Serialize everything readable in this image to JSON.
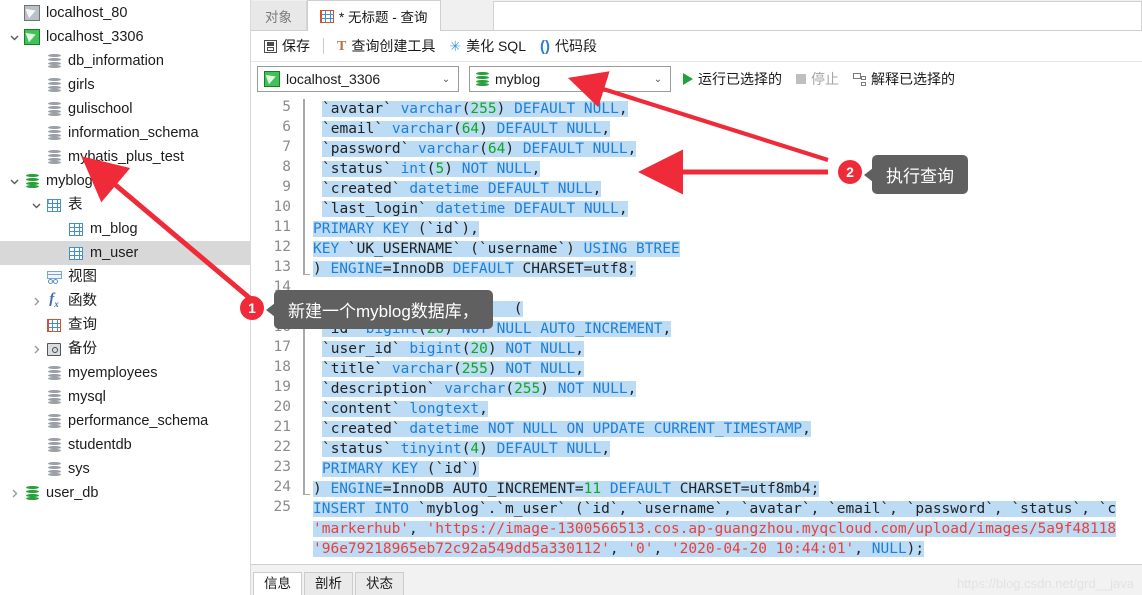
{
  "sidebar": {
    "items": [
      {
        "label": "localhost_80",
        "icon": "connection-icon",
        "indent": 1,
        "twist": "none",
        "state": "off",
        "selected": false
      },
      {
        "label": "localhost_3306",
        "icon": "connection-icon",
        "indent": 0,
        "twist": "down",
        "state": "on",
        "selected": false
      },
      {
        "label": "db_information",
        "icon": "database-icon",
        "indent": 2,
        "twist": "none",
        "state": "off",
        "selected": false
      },
      {
        "label": "girls",
        "icon": "database-icon",
        "indent": 2,
        "twist": "none",
        "state": "off",
        "selected": false
      },
      {
        "label": "gulischool",
        "icon": "database-icon",
        "indent": 2,
        "twist": "none",
        "state": "off",
        "selected": false
      },
      {
        "label": "information_schema",
        "icon": "database-icon",
        "indent": 2,
        "twist": "none",
        "state": "off",
        "selected": false
      },
      {
        "label": "mybatis_plus_test",
        "icon": "database-icon",
        "indent": 2,
        "twist": "none",
        "state": "off",
        "selected": false
      },
      {
        "label": "myblog",
        "icon": "database-icon",
        "indent": 1,
        "twist": "down",
        "state": "on",
        "selected": false
      },
      {
        "label": "表",
        "icon": "tables-folder-icon",
        "indent": 2,
        "twist": "down",
        "state": "off",
        "selected": false
      },
      {
        "label": "m_blog",
        "icon": "table-icon",
        "indent": 3,
        "twist": "none",
        "state": "off",
        "selected": false
      },
      {
        "label": "m_user",
        "icon": "table-icon",
        "indent": 3,
        "twist": "none",
        "state": "off",
        "selected": true
      },
      {
        "label": "视图",
        "icon": "view-icon",
        "indent": 2,
        "twist": "none",
        "state": "off",
        "selected": false
      },
      {
        "label": "函数",
        "icon": "function-icon",
        "indent": 2,
        "twist": "right",
        "state": "off",
        "selected": false
      },
      {
        "label": "查询",
        "icon": "query-icon",
        "indent": 2,
        "twist": "none",
        "state": "off",
        "selected": false
      },
      {
        "label": "备份",
        "icon": "backup-icon",
        "indent": 2,
        "twist": "right",
        "state": "off",
        "selected": false
      },
      {
        "label": "myemployees",
        "icon": "database-icon",
        "indent": 2,
        "twist": "none",
        "state": "off",
        "selected": false
      },
      {
        "label": "mysql",
        "icon": "database-icon",
        "indent": 2,
        "twist": "none",
        "state": "off",
        "selected": false
      },
      {
        "label": "performance_schema",
        "icon": "database-icon",
        "indent": 2,
        "twist": "none",
        "state": "off",
        "selected": false
      },
      {
        "label": "studentdb",
        "icon": "database-icon",
        "indent": 2,
        "twist": "none",
        "state": "off",
        "selected": false
      },
      {
        "label": "sys",
        "icon": "database-icon",
        "indent": 2,
        "twist": "none",
        "state": "off",
        "selected": false
      },
      {
        "label": "user_db",
        "icon": "database-icon",
        "indent": 1,
        "twist": "right",
        "state": "on",
        "selected": false
      }
    ]
  },
  "tabs": {
    "object_tab": "对象",
    "query_tab": "* 无标题 - 查询"
  },
  "toolbar": {
    "save": "保存",
    "query_builder": "查询创建工具",
    "beautify_sql": "美化 SQL",
    "code_snippet": "代码段"
  },
  "connbar": {
    "connection": "localhost_3306",
    "database": "myblog",
    "run_selected": "运行已选择的",
    "stop": "停止",
    "explain_selected": "解释已选择的"
  },
  "editor": {
    "first_line_number": 5,
    "lines": [
      {
        "n": 5,
        "indent": 1,
        "segs": [
          {
            "t": "`avatar` ",
            "c": "pl"
          },
          {
            "t": "varchar",
            "c": "kw"
          },
          {
            "t": "(",
            "c": "pl"
          },
          {
            "t": "255",
            "c": "num"
          },
          {
            "t": ") ",
            "c": "pl"
          },
          {
            "t": "DEFAULT NULL",
            "c": "kw"
          },
          {
            "t": ",",
            "c": "pl"
          }
        ]
      },
      {
        "n": 6,
        "indent": 1,
        "segs": [
          {
            "t": "`email` ",
            "c": "pl"
          },
          {
            "t": "varchar",
            "c": "kw"
          },
          {
            "t": "(",
            "c": "pl"
          },
          {
            "t": "64",
            "c": "num"
          },
          {
            "t": ") ",
            "c": "pl"
          },
          {
            "t": "DEFAULT NULL",
            "c": "kw"
          },
          {
            "t": ",",
            "c": "pl"
          }
        ]
      },
      {
        "n": 7,
        "indent": 1,
        "segs": [
          {
            "t": "`password` ",
            "c": "pl"
          },
          {
            "t": "varchar",
            "c": "kw"
          },
          {
            "t": "(",
            "c": "pl"
          },
          {
            "t": "64",
            "c": "num"
          },
          {
            "t": ") ",
            "c": "pl"
          },
          {
            "t": "DEFAULT NULL",
            "c": "kw"
          },
          {
            "t": ",",
            "c": "pl"
          }
        ]
      },
      {
        "n": 8,
        "indent": 1,
        "segs": [
          {
            "t": "`status` ",
            "c": "pl"
          },
          {
            "t": "int",
            "c": "kw"
          },
          {
            "t": "(",
            "c": "pl"
          },
          {
            "t": "5",
            "c": "num"
          },
          {
            "t": ") ",
            "c": "pl"
          },
          {
            "t": "NOT NULL",
            "c": "kw"
          },
          {
            "t": ",",
            "c": "pl"
          }
        ]
      },
      {
        "n": 9,
        "indent": 1,
        "segs": [
          {
            "t": "`created` ",
            "c": "pl"
          },
          {
            "t": "datetime",
            "c": "kw"
          },
          {
            "t": " ",
            "c": "pl"
          },
          {
            "t": "DEFAULT NULL",
            "c": "kw"
          },
          {
            "t": ",",
            "c": "pl"
          }
        ]
      },
      {
        "n": 10,
        "indent": 1,
        "segs": [
          {
            "t": "`last_login` ",
            "c": "pl"
          },
          {
            "t": "datetime",
            "c": "kw"
          },
          {
            "t": " ",
            "c": "pl"
          },
          {
            "t": "DEFAULT NULL",
            "c": "kw"
          },
          {
            "t": ",",
            "c": "pl"
          }
        ]
      },
      {
        "n": 11,
        "indent": 0,
        "segs": [
          {
            "t": "PRIMARY KEY",
            "c": "kw"
          },
          {
            "t": " (`id`),",
            "c": "pl"
          }
        ]
      },
      {
        "n": 12,
        "indent": 0,
        "segs": [
          {
            "t": "KEY",
            "c": "kw"
          },
          {
            "t": " `UK_USERNAME` (`username`) ",
            "c": "pl"
          },
          {
            "t": "USING BTREE",
            "c": "kw"
          }
        ]
      },
      {
        "n": 13,
        "indent": 0,
        "segs": [
          {
            "t": ") ",
            "c": "pl"
          },
          {
            "t": "ENGINE",
            "c": "kw"
          },
          {
            "t": "=",
            "c": "pl"
          },
          {
            "t": "InnoDB ",
            "c": "pl"
          },
          {
            "t": "DEFAULT",
            "c": "kw"
          },
          {
            "t": " CHARSET=utf8;",
            "c": "pl"
          }
        ]
      },
      {
        "n": 14,
        "indent": 0,
        "segs": [
          {
            "t": "",
            "c": "pl"
          }
        ]
      },
      {
        "n": 15,
        "indent": 0,
        "segs": [
          {
            "t": "CREATE TABLE",
            "c": "kw"
          },
          {
            "t": " `m_blog`  (",
            "c": "pl"
          }
        ]
      },
      {
        "n": 16,
        "indent": 1,
        "segs": [
          {
            "t": "`id` ",
            "c": "pl"
          },
          {
            "t": "bigint",
            "c": "kw"
          },
          {
            "t": "(",
            "c": "pl"
          },
          {
            "t": "20",
            "c": "num"
          },
          {
            "t": ") ",
            "c": "pl"
          },
          {
            "t": "NOT NULL AUTO_INCREMENT",
            "c": "kw"
          },
          {
            "t": ",",
            "c": "pl"
          }
        ]
      },
      {
        "n": 17,
        "indent": 1,
        "segs": [
          {
            "t": "`user_id` ",
            "c": "pl"
          },
          {
            "t": "bigint",
            "c": "kw"
          },
          {
            "t": "(",
            "c": "pl"
          },
          {
            "t": "20",
            "c": "num"
          },
          {
            "t": ") ",
            "c": "pl"
          },
          {
            "t": "NOT NULL",
            "c": "kw"
          },
          {
            "t": ",",
            "c": "pl"
          }
        ]
      },
      {
        "n": 18,
        "indent": 1,
        "segs": [
          {
            "t": "`title` ",
            "c": "pl"
          },
          {
            "t": "varchar",
            "c": "kw"
          },
          {
            "t": "(",
            "c": "pl"
          },
          {
            "t": "255",
            "c": "num"
          },
          {
            "t": ") ",
            "c": "pl"
          },
          {
            "t": "NOT NULL",
            "c": "kw"
          },
          {
            "t": ",",
            "c": "pl"
          }
        ]
      },
      {
        "n": 19,
        "indent": 1,
        "segs": [
          {
            "t": "`description` ",
            "c": "pl"
          },
          {
            "t": "varchar",
            "c": "kw"
          },
          {
            "t": "(",
            "c": "pl"
          },
          {
            "t": "255",
            "c": "num"
          },
          {
            "t": ") ",
            "c": "pl"
          },
          {
            "t": "NOT NULL",
            "c": "kw"
          },
          {
            "t": ",",
            "c": "pl"
          }
        ]
      },
      {
        "n": 20,
        "indent": 1,
        "segs": [
          {
            "t": "`content` ",
            "c": "pl"
          },
          {
            "t": "longtext",
            "c": "kw"
          },
          {
            "t": ",",
            "c": "pl"
          }
        ]
      },
      {
        "n": 21,
        "indent": 1,
        "segs": [
          {
            "t": "`created` ",
            "c": "pl"
          },
          {
            "t": "datetime",
            "c": "kw"
          },
          {
            "t": " ",
            "c": "pl"
          },
          {
            "t": "NOT NULL ON UPDATE CURRENT_TIMESTAMP",
            "c": "kw"
          },
          {
            "t": ",",
            "c": "pl"
          }
        ]
      },
      {
        "n": 22,
        "indent": 1,
        "segs": [
          {
            "t": "`status` ",
            "c": "pl"
          },
          {
            "t": "tinyint",
            "c": "kw"
          },
          {
            "t": "(",
            "c": "pl"
          },
          {
            "t": "4",
            "c": "num"
          },
          {
            "t": ") ",
            "c": "pl"
          },
          {
            "t": "DEFAULT NULL",
            "c": "kw"
          },
          {
            "t": ",",
            "c": "pl"
          }
        ]
      },
      {
        "n": 23,
        "indent": 1,
        "segs": [
          {
            "t": "PRIMARY KEY",
            "c": "kw"
          },
          {
            "t": " (`id`)",
            "c": "pl"
          }
        ]
      },
      {
        "n": 24,
        "indent": 0,
        "segs": [
          {
            "t": ") ",
            "c": "pl"
          },
          {
            "t": "ENGINE",
            "c": "kw"
          },
          {
            "t": "=",
            "c": "pl"
          },
          {
            "t": "InnoDB AUTO_INCREMENT=",
            "c": "pl"
          },
          {
            "t": "11",
            "c": "num"
          },
          {
            "t": " ",
            "c": "pl"
          },
          {
            "t": "DEFAULT",
            "c": "kw"
          },
          {
            "t": " CHARSET=utf8mb4;",
            "c": "pl"
          }
        ]
      },
      {
        "n": 25,
        "indent": 0,
        "segs": [
          {
            "t": "INSERT INTO",
            "c": "kw"
          },
          {
            "t": " `myblog`.`m_user` (`id`, `username`, `avatar`, `email`, `password`, `status`, `c",
            "c": "pl"
          }
        ]
      },
      {
        "n": null,
        "indent": 0,
        "segs": [
          {
            "t": "'markerhub'",
            "c": "str"
          },
          {
            "t": ", ",
            "c": "pl"
          },
          {
            "t": "'https://image-1300566513.cos.ap-guangzhou.myqcloud.com/upload/images/5a9f48118",
            "c": "str"
          }
        ]
      },
      {
        "n": null,
        "indent": 0,
        "segs": [
          {
            "t": "'96e79218965eb72c92a549dd5a330112'",
            "c": "str"
          },
          {
            "t": ", ",
            "c": "pl"
          },
          {
            "t": "'0'",
            "c": "str"
          },
          {
            "t": ", ",
            "c": "pl"
          },
          {
            "t": "'2020-04-20 10:44:01'",
            "c": "str"
          },
          {
            "t": ", ",
            "c": "pl"
          },
          {
            "t": "NULL",
            "c": "kw"
          },
          {
            "t": ");",
            "c": "pl"
          }
        ]
      }
    ]
  },
  "annotations": [
    {
      "number": "1",
      "text": "新建一个myblog数据库，"
    },
    {
      "number": "2",
      "text": "执行查询"
    }
  ],
  "bottom": {
    "tabs": [
      "信息",
      "剖析",
      "状态"
    ],
    "active_index": 0
  },
  "watermark": "https://blog.csdn.net/grd__java",
  "colors": {
    "accent_red": "#ef2b3a",
    "selection_blue": "#bcdcf5",
    "keyword_blue": "#1f7fd6",
    "string_red": "#e8403c",
    "number_green": "#0fa81f",
    "callout_gray": "#606060",
    "db_green": "#28a03c"
  }
}
